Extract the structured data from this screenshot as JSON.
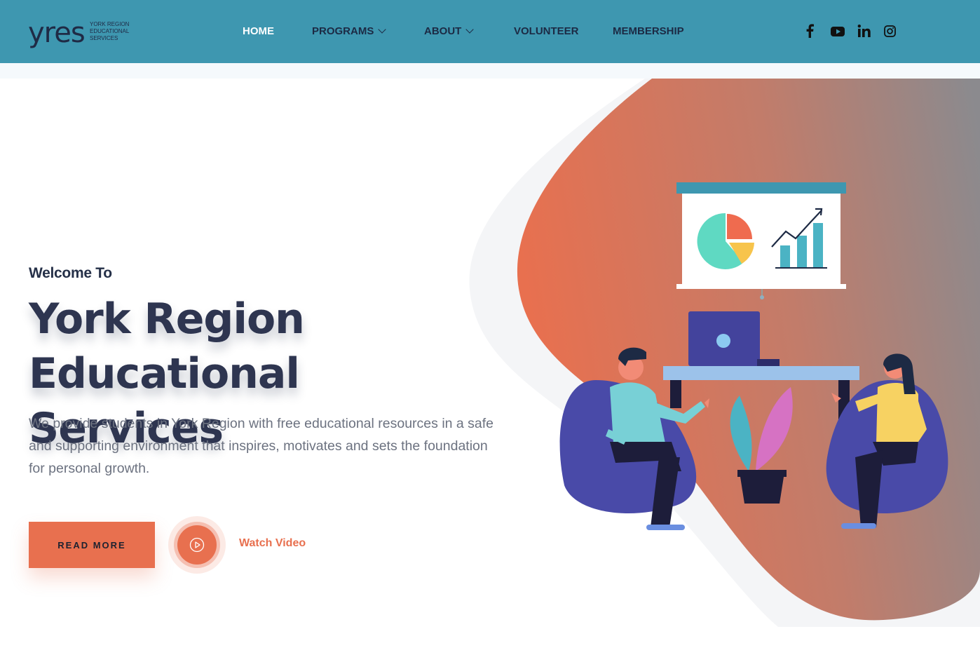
{
  "brand": {
    "logo_text": "yres",
    "logo_sub": [
      "YORK REGION",
      "EDUCATIONAL",
      "SERVICES"
    ]
  },
  "nav": {
    "items": [
      {
        "label": "HOME",
        "active": true,
        "has_dropdown": false
      },
      {
        "label": "PROGRAMS",
        "active": false,
        "has_dropdown": true
      },
      {
        "label": "ABOUT",
        "active": false,
        "has_dropdown": true
      },
      {
        "label": "VOLUNTEER",
        "active": false,
        "has_dropdown": false
      },
      {
        "label": "MEMBERSHIP",
        "active": false,
        "has_dropdown": false
      }
    ],
    "social": [
      "facebook-icon",
      "youtube-icon",
      "linkedin-icon",
      "instagram-icon"
    ]
  },
  "hero": {
    "welcome": "Welcome To",
    "title_line1": "York Region",
    "title_line2": "Educational Services",
    "description": "We provide students in York Region with free educational resources in a safe and supporting environment that inspires, motivates and sets the foundation for personal growth.",
    "read_more": "READ MORE",
    "watch_video": "Watch Video"
  },
  "colors": {
    "nav_bg": "#3e97b0",
    "accent": "#e8704f",
    "dark": "#2e3550",
    "blob_start": "#e8704f",
    "blob_end": "#8a8a8f"
  }
}
